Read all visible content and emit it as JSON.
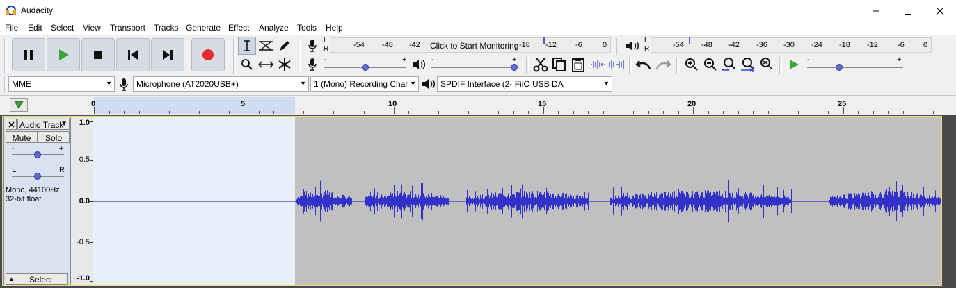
{
  "window": {
    "title": "Audacity"
  },
  "menu": [
    "File",
    "Edit",
    "Select",
    "View",
    "Transport",
    "Tracks",
    "Generate",
    "Effect",
    "Analyze",
    "Tools",
    "Help"
  ],
  "record_meter": {
    "hint": "Click to Start Monitoring",
    "scale": [
      "-54",
      "-48",
      "-42",
      "-18",
      "-12",
      "-6",
      "0"
    ],
    "channels": [
      "L",
      "R"
    ]
  },
  "playback_meter": {
    "scale": [
      "-54",
      "-48",
      "-42",
      "-36",
      "-30",
      "-24",
      "-18",
      "-12",
      "-6",
      "0"
    ],
    "channels": [
      "L",
      "R"
    ]
  },
  "slider_marks": {
    "minus": "-",
    "plus": "+"
  },
  "devices": {
    "host": "MME",
    "recording_device": "Microphone (AT2020USB+)",
    "channels": "1 (Mono) Recording Char",
    "playback_device": "SPDIF Interface (2- FiiO USB DA"
  },
  "timeline": {
    "labels": [
      "0",
      "5",
      "10",
      "15",
      "20",
      "25"
    ]
  },
  "track": {
    "name": "Audio Track",
    "mute": "Mute",
    "solo": "Solo",
    "gain_minus": "-",
    "gain_plus": "+",
    "pan_left": "L",
    "pan_right": "R",
    "format_line1": "Mono, 44100Hz",
    "format_line2": "32-bit float",
    "select": "Select"
  },
  "amplitude_labels": [
    "1.0",
    "0.5",
    "0.0",
    "-0.5",
    "-1.0"
  ],
  "colors": {
    "waveform": "#3232c8",
    "selection": "#e8eefa",
    "unselected_bg": "#c0c0c0",
    "record_red": "#e52d2d",
    "play_green": "#3aa635",
    "track_focus_border": "#e8e07a"
  }
}
